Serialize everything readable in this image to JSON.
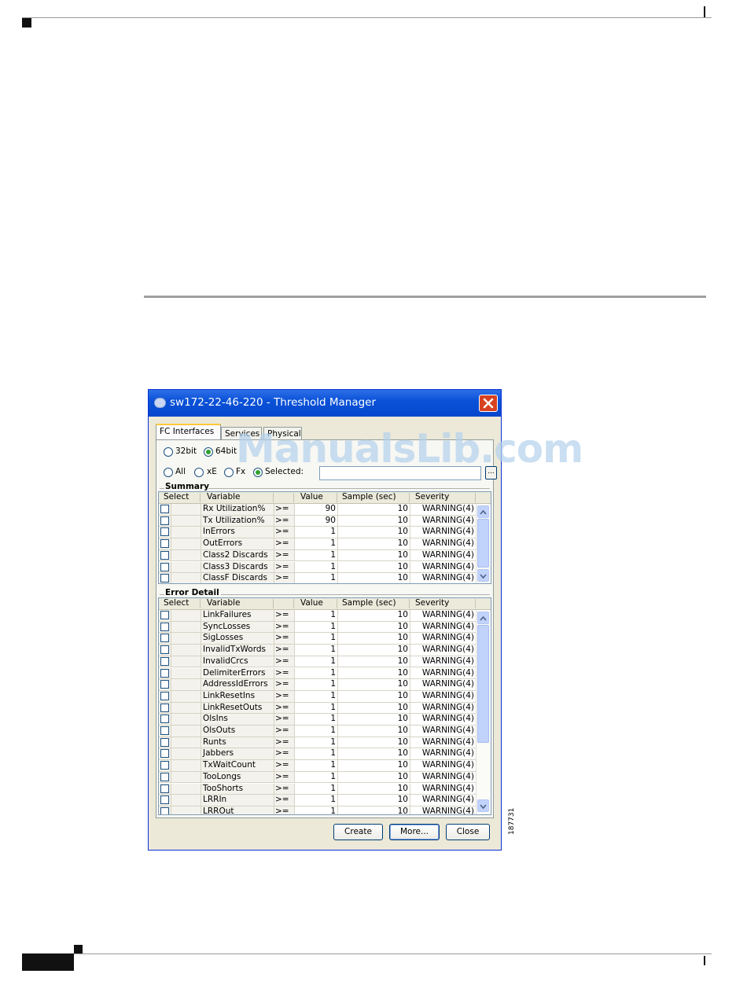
{
  "watermark": "ManualsLib.com",
  "figure_id": "187731",
  "window": {
    "title": "sw172-22-46-220 - Threshold Manager"
  },
  "tabs": [
    {
      "label": "FC Interfaces"
    },
    {
      "label": "Services"
    },
    {
      "label": "Physical"
    }
  ],
  "options": {
    "bits": [
      {
        "label": "32bit",
        "selected": false
      },
      {
        "label": "64bit",
        "selected": true
      }
    ],
    "scope": [
      {
        "label": "All",
        "selected": false
      },
      {
        "label": "xE",
        "selected": false
      },
      {
        "label": "Fx",
        "selected": false
      },
      {
        "label": "Selected:",
        "selected": true
      }
    ],
    "selected_value": "",
    "browse_label": "..."
  },
  "columns": {
    "select": "Select",
    "variable": "Variable",
    "value": "Value",
    "sample": "Sample (sec)",
    "severity": "Severity"
  },
  "summary": {
    "label": "Summary",
    "rows": [
      {
        "variable": "Rx Utilization%",
        "op": ">=",
        "value": "90",
        "sample": "10",
        "severity": "WARNING(4)"
      },
      {
        "variable": "Tx Utilization%",
        "op": ">=",
        "value": "90",
        "sample": "10",
        "severity": "WARNING(4)"
      },
      {
        "variable": "InErrors",
        "op": ">=",
        "value": "1",
        "sample": "10",
        "severity": "WARNING(4)"
      },
      {
        "variable": "OutErrors",
        "op": ">=",
        "value": "1",
        "sample": "10",
        "severity": "WARNING(4)"
      },
      {
        "variable": "Class2 Discards",
        "op": ">=",
        "value": "1",
        "sample": "10",
        "severity": "WARNING(4)"
      },
      {
        "variable": "Class3 Discards",
        "op": ">=",
        "value": "1",
        "sample": "10",
        "severity": "WARNING(4)"
      },
      {
        "variable": "ClassF Discards",
        "op": ">=",
        "value": "1",
        "sample": "10",
        "severity": "WARNING(4)"
      }
    ]
  },
  "error_detail": {
    "label": "Error Detail",
    "rows": [
      {
        "variable": "LinkFailures",
        "op": ">=",
        "value": "1",
        "sample": "10",
        "severity": "WARNING(4)"
      },
      {
        "variable": "SyncLosses",
        "op": ">=",
        "value": "1",
        "sample": "10",
        "severity": "WARNING(4)"
      },
      {
        "variable": "SigLosses",
        "op": ">=",
        "value": "1",
        "sample": "10",
        "severity": "WARNING(4)"
      },
      {
        "variable": "InvalidTxWords",
        "op": ">=",
        "value": "1",
        "sample": "10",
        "severity": "WARNING(4)"
      },
      {
        "variable": "InvalidCrcs",
        "op": ">=",
        "value": "1",
        "sample": "10",
        "severity": "WARNING(4)"
      },
      {
        "variable": "DelimiterErrors",
        "op": ">=",
        "value": "1",
        "sample": "10",
        "severity": "WARNING(4)"
      },
      {
        "variable": "AddressIdErrors",
        "op": ">=",
        "value": "1",
        "sample": "10",
        "severity": "WARNING(4)"
      },
      {
        "variable": "LinkResetIns",
        "op": ">=",
        "value": "1",
        "sample": "10",
        "severity": "WARNING(4)"
      },
      {
        "variable": "LinkResetOuts",
        "op": ">=",
        "value": "1",
        "sample": "10",
        "severity": "WARNING(4)"
      },
      {
        "variable": "OlsIns",
        "op": ">=",
        "value": "1",
        "sample": "10",
        "severity": "WARNING(4)"
      },
      {
        "variable": "OlsOuts",
        "op": ">=",
        "value": "1",
        "sample": "10",
        "severity": "WARNING(4)"
      },
      {
        "variable": "Runts",
        "op": ">=",
        "value": "1",
        "sample": "10",
        "severity": "WARNING(4)"
      },
      {
        "variable": "Jabbers",
        "op": ">=",
        "value": "1",
        "sample": "10",
        "severity": "WARNING(4)"
      },
      {
        "variable": "TxWaitCount",
        "op": ">=",
        "value": "1",
        "sample": "10",
        "severity": "WARNING(4)"
      },
      {
        "variable": "TooLongs",
        "op": ">=",
        "value": "1",
        "sample": "10",
        "severity": "WARNING(4)"
      },
      {
        "variable": "TooShorts",
        "op": ">=",
        "value": "1",
        "sample": "10",
        "severity": "WARNING(4)"
      },
      {
        "variable": "LRRIn",
        "op": ">=",
        "value": "1",
        "sample": "10",
        "severity": "WARNING(4)"
      },
      {
        "variable": "LRROut",
        "op": ">=",
        "value": "1",
        "sample": "10",
        "severity": "WARNING(4)"
      }
    ]
  },
  "buttons": {
    "create": "Create",
    "more": "More...",
    "close": "Close"
  },
  "colors": {
    "title_bar": "#0a52d8",
    "close_button": "#d84220",
    "dialog_bg": "#ece9d8",
    "selected_radio": "#2ea12e"
  },
  "icons": {
    "window": "app-icon",
    "close": "close-x-icon",
    "scroll_up": "chevron-up-icon",
    "scroll_down": "chevron-down-icon"
  }
}
